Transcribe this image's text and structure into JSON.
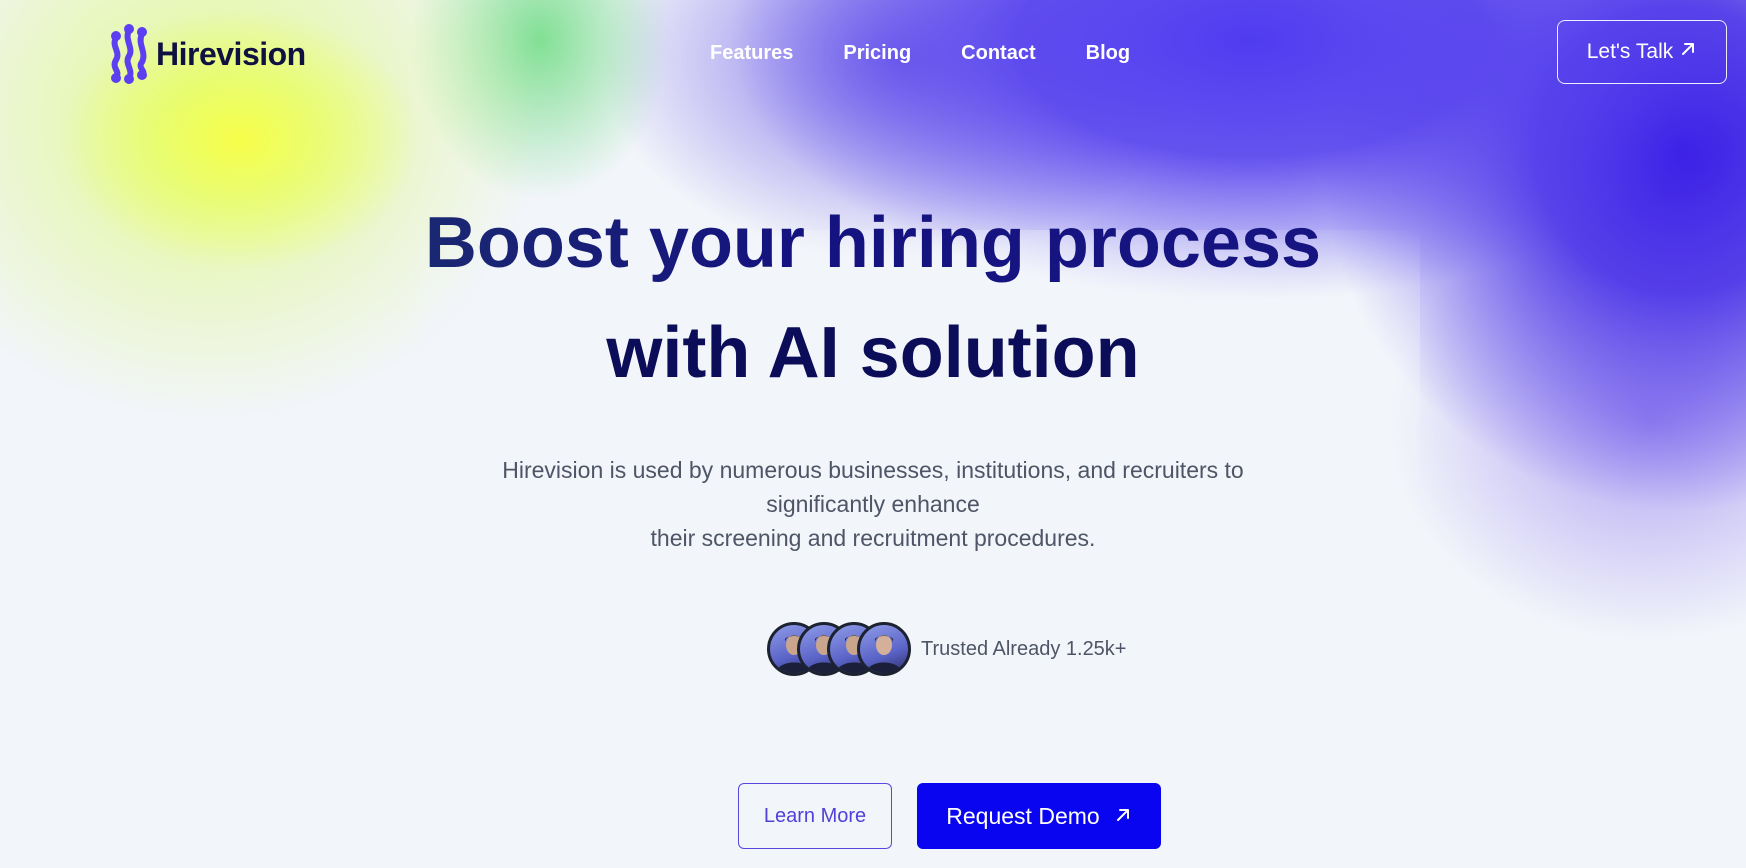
{
  "brand": {
    "name": "Hirevision",
    "logo_icon": "wave-dots-logo-icon",
    "logo_color": "#5b3ff0"
  },
  "nav": {
    "items": [
      "Features",
      "Pricing",
      "Contact",
      "Blog"
    ]
  },
  "header_cta": {
    "label": "Let's Talk",
    "icon": "arrow-up-right-icon"
  },
  "hero": {
    "title_line1": "Boost your hiring process",
    "title_line2": "with AI solution",
    "subtitle_line1": "Hirevision is used by numerous businesses, institutions, and recruiters to significantly enhance",
    "subtitle_line2": "their screening and recruitment procedures."
  },
  "trust": {
    "avatar_count": 4,
    "text": "Trusted Already 1.25k+"
  },
  "actions": {
    "secondary_label": "Learn More",
    "primary_label": "Request Demo",
    "primary_icon": "arrow-up-right-icon"
  },
  "colors": {
    "primary": "#0a05f0",
    "heading": "#0c0d58",
    "body_text": "#4d5566",
    "accent_yellow": "#f8ff46",
    "accent_purple": "#3a1ee6"
  }
}
